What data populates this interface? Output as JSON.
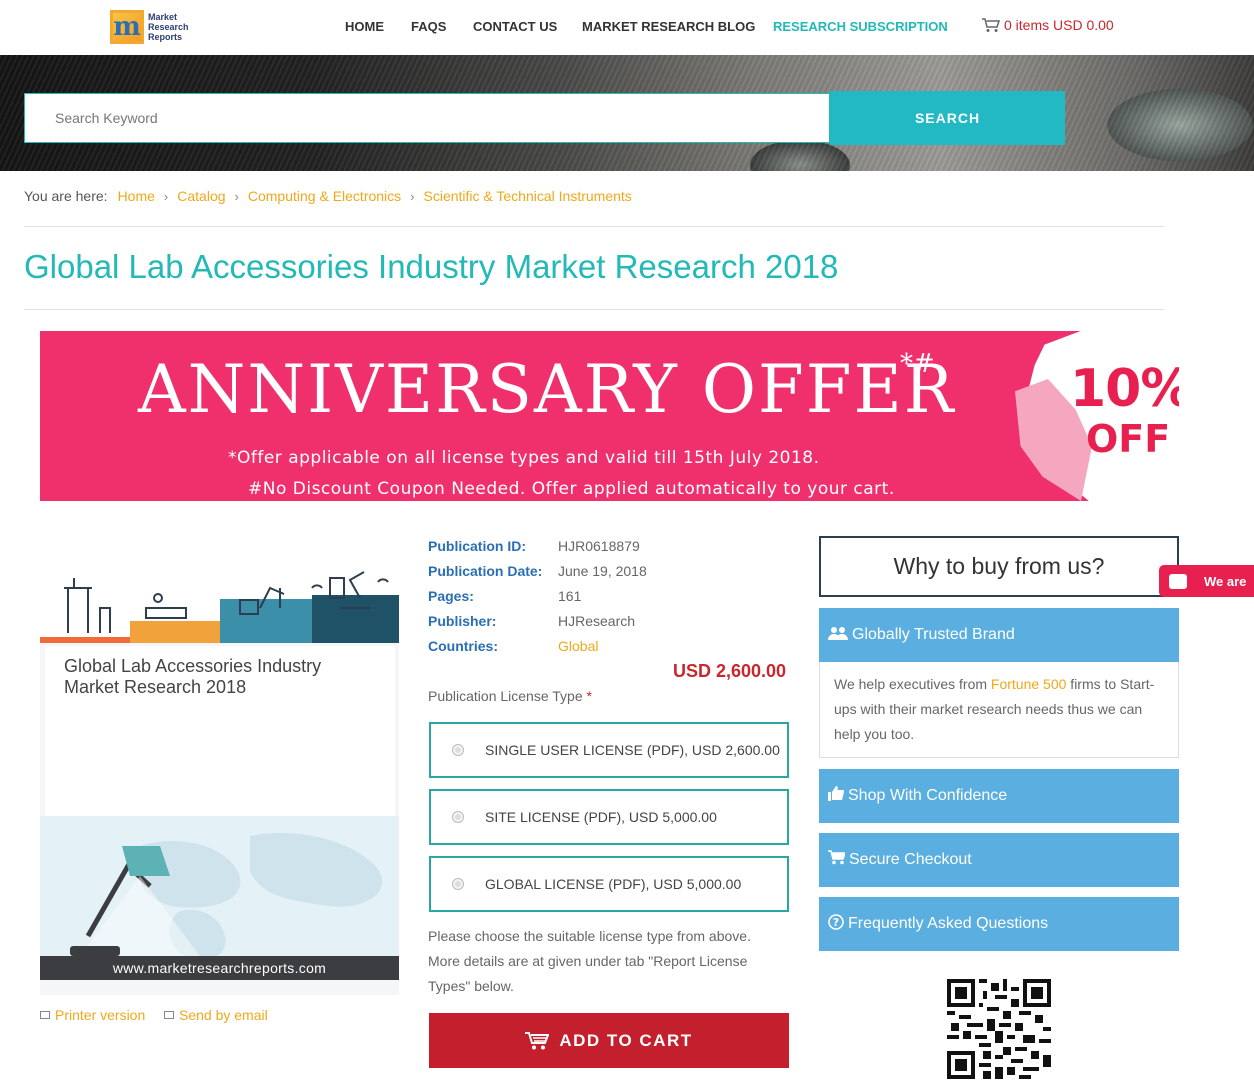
{
  "header": {
    "logo_text": [
      "Market",
      "Research",
      "Reports"
    ],
    "nav": [
      {
        "label": "HOME"
      },
      {
        "label": "FAQS"
      },
      {
        "label": "CONTACT US"
      },
      {
        "label": "MARKET RESEARCH BLOG"
      },
      {
        "label": "RESEARCH SUBSCRIPTION"
      }
    ],
    "cart_label": "0 items USD 0.00"
  },
  "search": {
    "placeholder": "Search Keyword",
    "button_label": "SEARCH"
  },
  "breadcrumb": {
    "prefix": "You are here:",
    "items": [
      "Home",
      "Catalog",
      "Computing & Electronics",
      "Scientific & Technical Instruments"
    ]
  },
  "page_title": "Global Lab Accessories Industry Market Research 2018",
  "banner": {
    "title": "ANNIVERSARY OFFER",
    "marks": "*#",
    "line1": "*Offer applicable on all license types and valid till 15th July 2018.",
    "line2": "#No Discount Coupon Needed. Offer applied automatically to your cart.",
    "percent": "10%",
    "off": "OFF"
  },
  "product": {
    "card_title": "Global Lab Accessories Industry Market Research 2018",
    "card_footer": "www.marketresearchreports.com",
    "printer_label": "Printer version",
    "email_label": "Send by email"
  },
  "details": [
    {
      "label": "Publication ID:",
      "value": "HJR0618879"
    },
    {
      "label": "Publication Date:",
      "value": "June 19, 2018"
    },
    {
      "label": "Pages:",
      "value": "161"
    },
    {
      "label": "Publisher:",
      "value": "HJResearch"
    },
    {
      "label": "Countries:",
      "value": "Global"
    }
  ],
  "price": "USD 2,600.00",
  "license": {
    "type_label": "Publication License Type",
    "required_mark": "*",
    "options": [
      {
        "label": "SINGLE USER LICENSE (PDF), USD 2,600.00"
      },
      {
        "label": "SITE LICENSE (PDF), USD 5,000.00"
      },
      {
        "label": "GLOBAL LICENSE (PDF), USD 5,000.00"
      }
    ],
    "help_text": "Please choose the suitable license type from above. More details are at given under tab \"Report License Types\" below.",
    "add_to_cart_label": "ADD TO CART"
  },
  "sidebar": {
    "why_title": "Why to buy from us?",
    "trusted_title": "Globally Trusted Brand",
    "trusted_body_pre": "We help executives from ",
    "trusted_body_hl": "Fortune 500",
    "trusted_body_post": " firms to Start-ups with their market research needs thus we can help you too.",
    "shop_label": "Shop With Confidence",
    "secure_label": "Secure Checkout",
    "faq_label": "Frequently Asked Questions"
  },
  "chat": {
    "label": "We are"
  },
  "colors": {
    "accent_teal": "#22b9b7",
    "link_orange": "#f0a81a",
    "price_red": "#c9272d",
    "banner_pink": "#f0306c",
    "sidebar_blue": "#5aafe0",
    "cart_button": "#c41f2d"
  }
}
